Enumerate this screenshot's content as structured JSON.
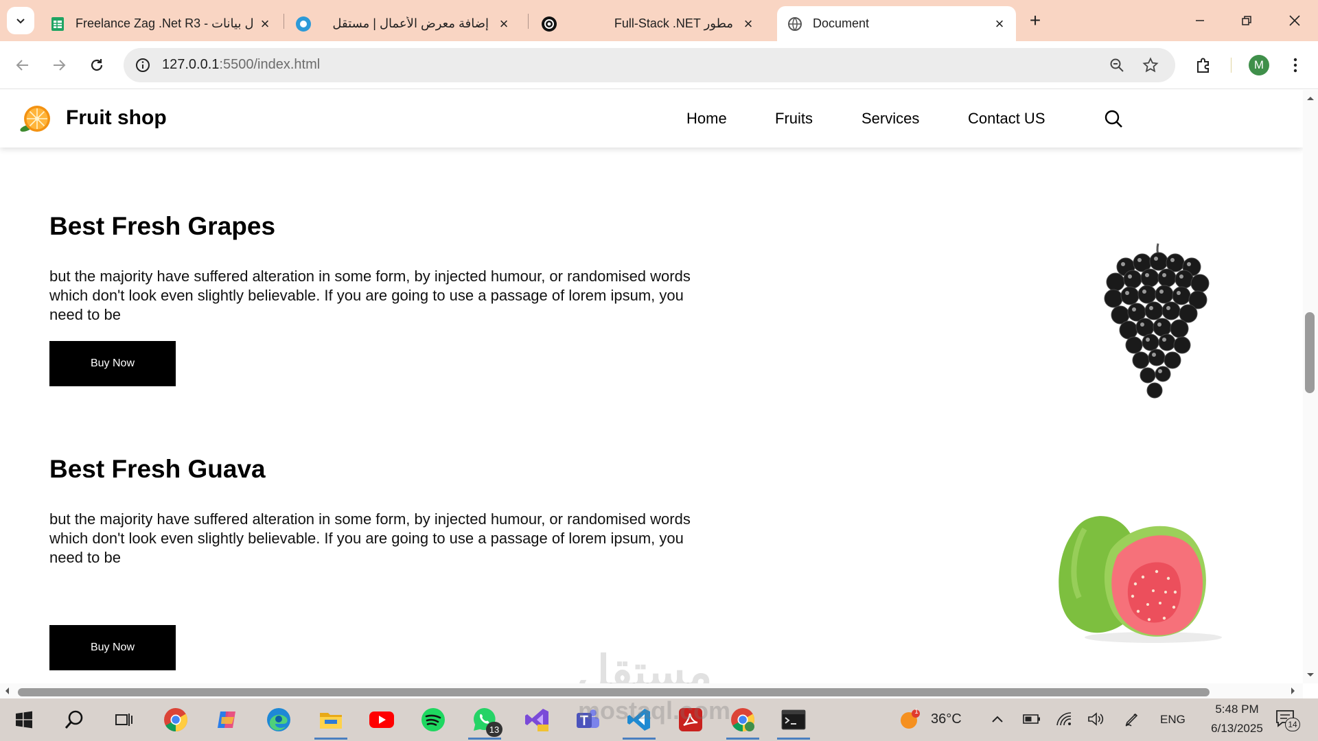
{
  "browser": {
    "tabs": [
      {
        "title": "Freelance Zag .Net R3 - ل بيانات",
        "icon": "sheets-icon",
        "active": false
      },
      {
        "title": "إضافة معرض الأعمال | مستقل",
        "icon": "mostaql-icon",
        "active": false
      },
      {
        "title": "Full-Stack .NET مطور",
        "icon": "chatgpt-icon",
        "active": false
      },
      {
        "title": "Document",
        "icon": "globe-icon",
        "active": true
      }
    ],
    "url_host": "127.0.0.1",
    "url_rest": ":5500/index.html",
    "profile_initial": "M"
  },
  "site": {
    "brand": "Fruit shop",
    "nav": [
      "Home",
      "Fruits",
      "Services",
      "Contact US"
    ],
    "products": [
      {
        "title": "Best Fresh Grapes",
        "description": "but the majority have suffered alteration in some form, by injected humour, or randomised words which don't look even slightly believable. If you are going to use a passage of lorem ipsum, you need to be",
        "button": "Buy Now",
        "image": "black-grapes"
      },
      {
        "title": "Best Fresh Guava",
        "description": "but the majority have suffered alteration in some form, by injected humour, or randomised words which don't look even slightly believable. If you are going to use a passage of lorem ipsum, you need to be",
        "button": "Buy Now",
        "image": "guava"
      }
    ]
  },
  "watermark": {
    "arabic": "مستقل",
    "latin": "mostaql.com"
  },
  "taskbar": {
    "apps": [
      "windows-start-icon",
      "search-icon",
      "task-view-icon",
      "chrome-icon",
      "copilot-icon",
      "edge-icon",
      "file-explorer-icon",
      "youtube-icon",
      "spotify-icon",
      "whatsapp-icon",
      "visual-studio-icon",
      "teams-icon",
      "vscode-icon",
      "acrobat-icon",
      "chrome-profile-icon",
      "terminal-icon"
    ],
    "whatsapp_badge": "13",
    "weather_badge": "1",
    "temperature": "36°C",
    "language": "ENG",
    "time": "5:48 PM",
    "date": "6/13/2025",
    "notification_count": "14"
  },
  "colors": {
    "tabstrip": "#f9d5c3",
    "button": "#000000",
    "taskbar": "#d9d2cd"
  }
}
